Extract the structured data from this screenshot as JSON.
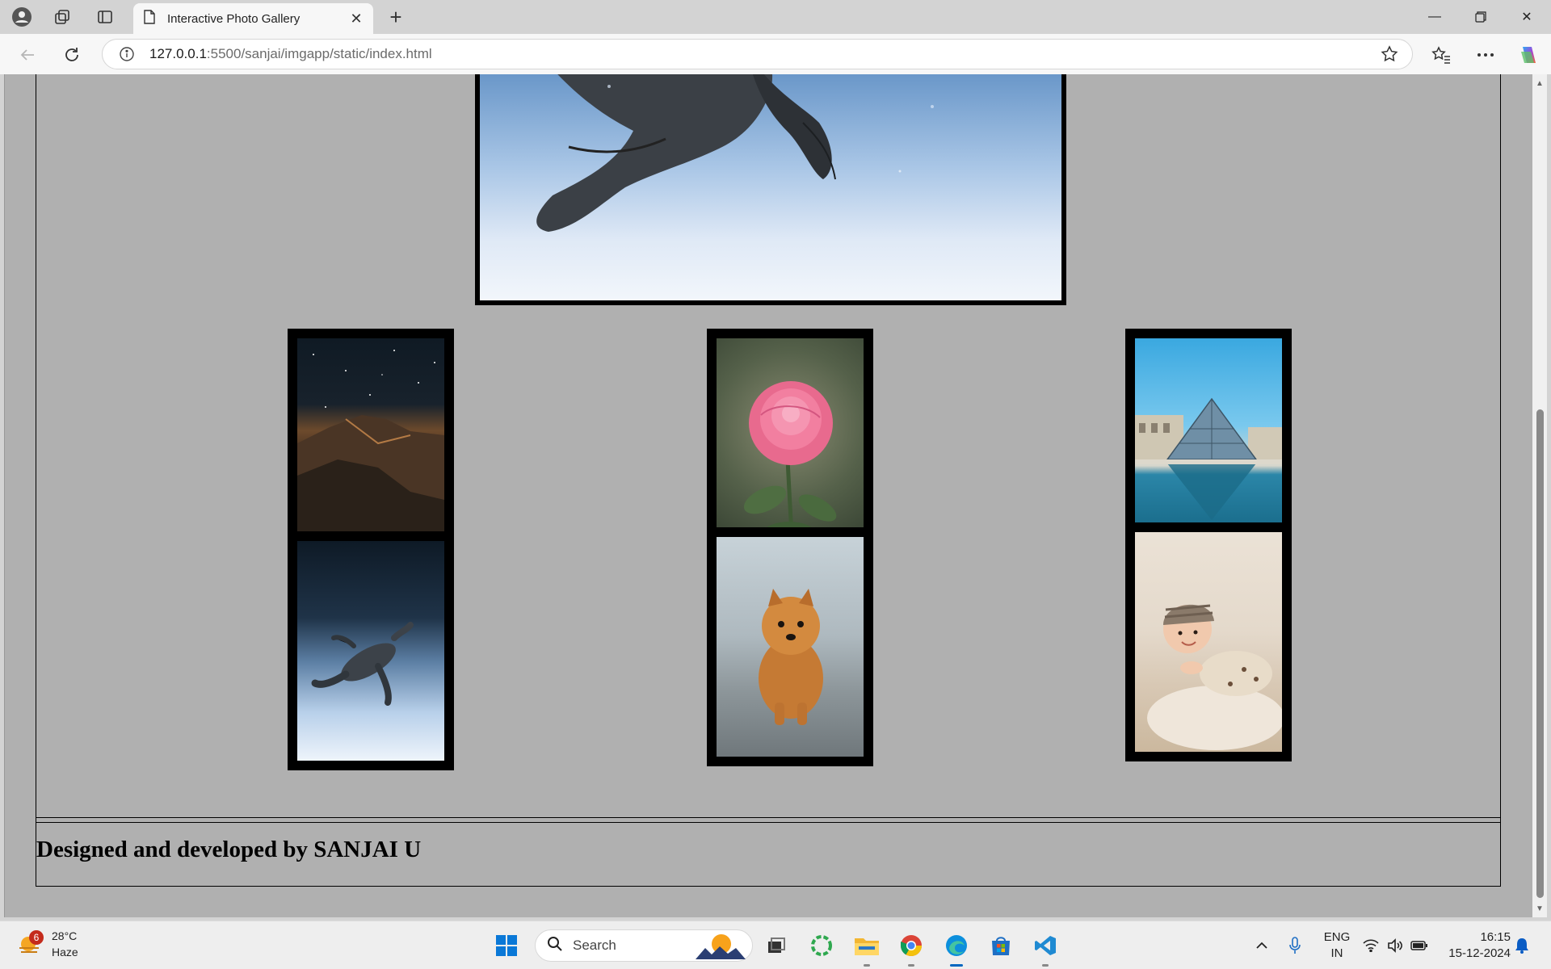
{
  "browser": {
    "tab_title": "Interactive Photo Gallery",
    "url_host": "127.0.0.1",
    "url_path": ":5500/sanjai/imgapp/static/index.html"
  },
  "page": {
    "footer_text": "Designed and developed by SANJAI U",
    "gallery": [
      {
        "subject": "night mountain landscape"
      },
      {
        "subject": "pink rose"
      },
      {
        "subject": "louvre pyramid"
      },
      {
        "subject": "sea turtle"
      },
      {
        "subject": "pomeranian puppy"
      },
      {
        "subject": "baby on rug"
      }
    ]
  },
  "taskbar": {
    "weather_temp": "28°C",
    "weather_desc": "Haze",
    "weather_badge": "6",
    "search_label": "Search",
    "lang_line1": "ENG",
    "lang_line2": "IN",
    "time": "16:15",
    "date": "15-12-2024"
  },
  "colors": {
    "page_background": "#b0b0b0",
    "frame": "#000000",
    "accent": "#0067c0"
  }
}
